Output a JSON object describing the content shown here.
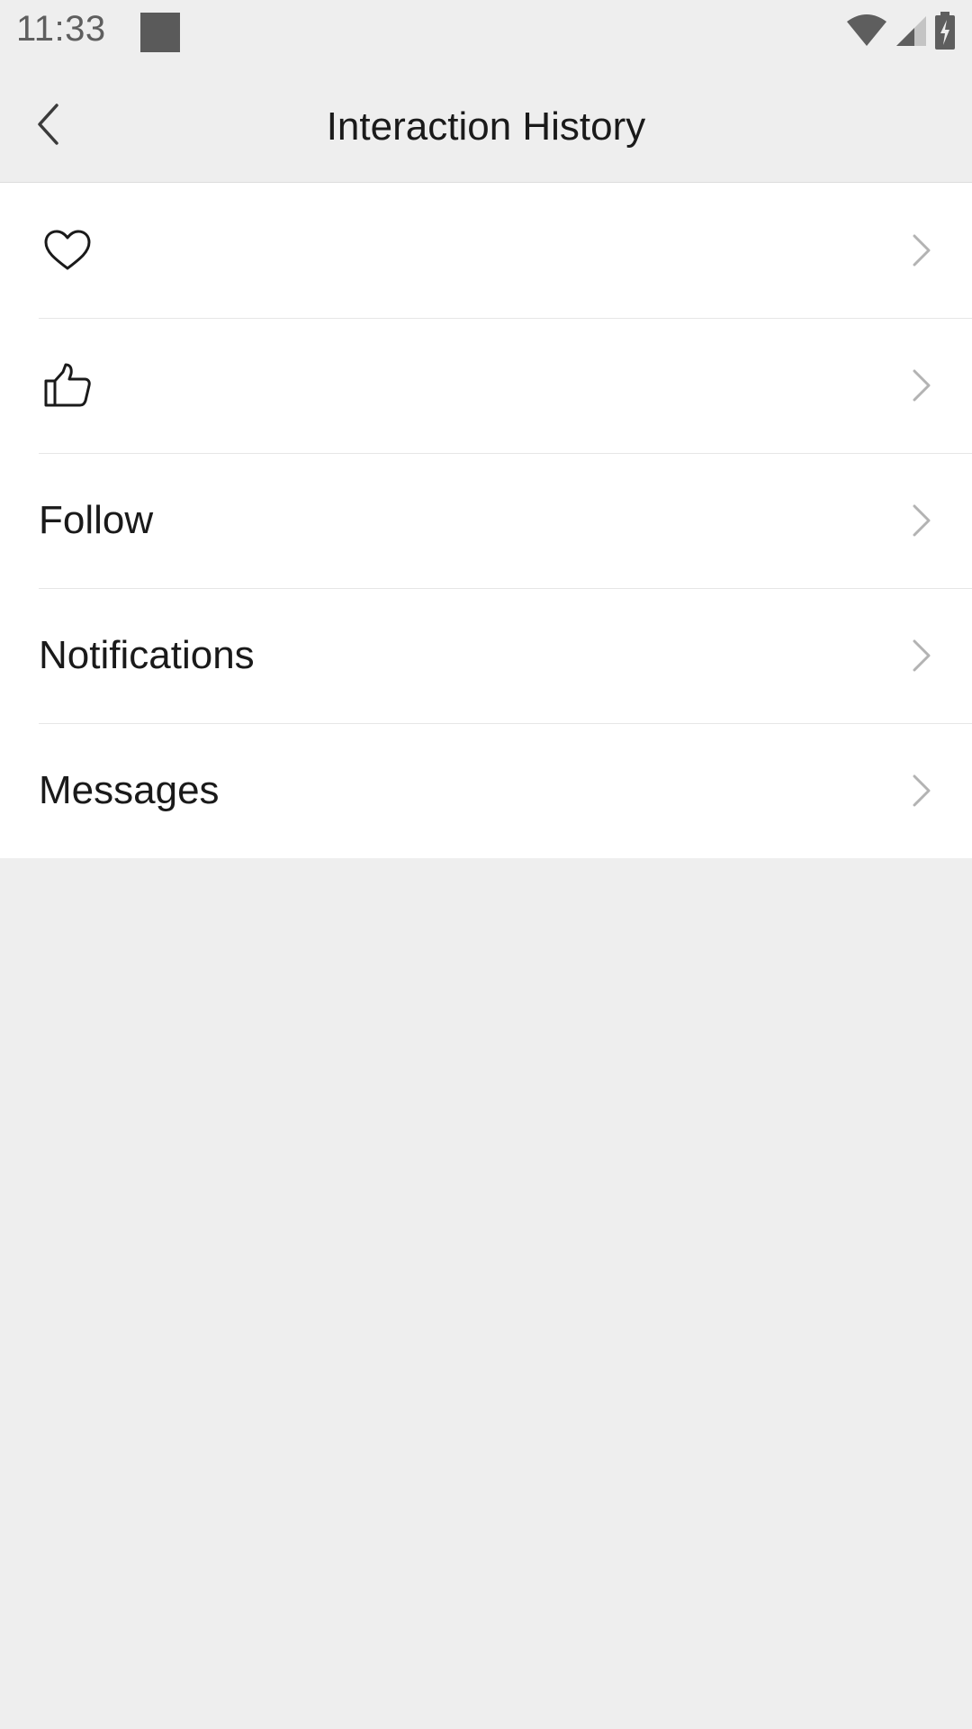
{
  "status_bar": {
    "time": "11:33",
    "icons": [
      "notification-square-icon",
      "wifi-icon",
      "signal-icon",
      "battery-charging-icon"
    ]
  },
  "app_bar": {
    "title": "Interaction History",
    "back_icon": "chevron-left-icon"
  },
  "list": {
    "items": [
      {
        "icon": "heart-outline-icon",
        "label": ""
      },
      {
        "icon": "thumbs-up-outline-icon",
        "label": ""
      },
      {
        "icon": "",
        "label": "Follow"
      },
      {
        "icon": "",
        "label": "Notifications"
      },
      {
        "icon": "",
        "label": "Messages"
      }
    ],
    "chevron_icon": "chevron-right-icon"
  },
  "colors": {
    "background": "#eeeeee",
    "surface": "#ffffff",
    "text_primary": "#1a1a1a",
    "text_status": "#5e5e5e",
    "chevron": "#b3b3b3",
    "divider": "#e6e6e6"
  }
}
